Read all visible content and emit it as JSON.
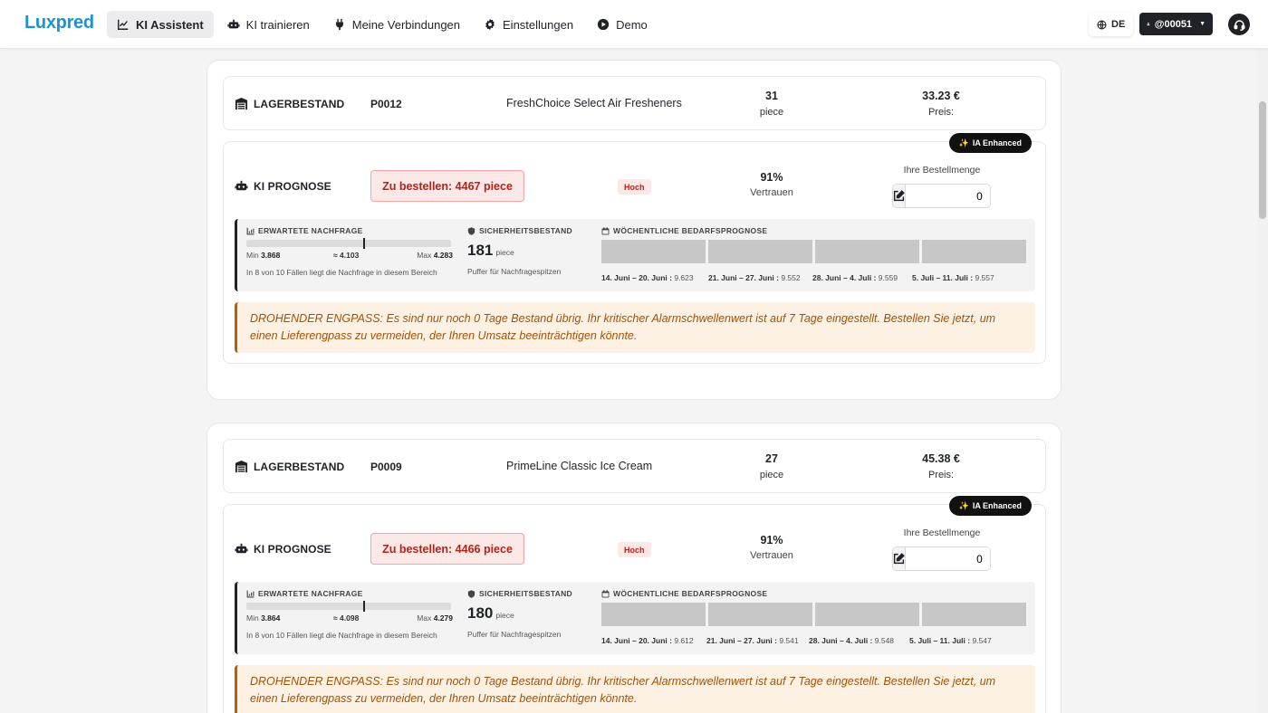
{
  "nav": {
    "brand": "Luxpred",
    "items": [
      {
        "label": "KI Assistent",
        "icon": "chart-line-icon",
        "active": true
      },
      {
        "label": "KI trainieren",
        "icon": "robot-icon",
        "active": false
      },
      {
        "label": "Meine Verbindungen",
        "icon": "plug-icon",
        "active": false
      },
      {
        "label": "Einstellungen",
        "icon": "gear-icon",
        "active": false
      },
      {
        "label": "Demo",
        "icon": "play-circle-icon",
        "active": false
      }
    ],
    "language": "DE",
    "user": "@00051"
  },
  "products": [
    {
      "stock_label": "LAGERBESTAND",
      "sku": "P0012",
      "name": "FreshChoice Select Air Fresheners",
      "stock_qty": "31",
      "stock_unit": "piece",
      "price": "33.23 €",
      "price_label": "Preis:",
      "ia_badge": "IA Enhanced",
      "forecast_label": "KI PROGNOSE",
      "order_text": "Zu bestellen: 4467 piece",
      "priority": "Hoch",
      "confidence": "91%",
      "confidence_label": "Vertrauen",
      "qty_label": "Ihre Bestellmenge",
      "qty_value": "0",
      "demand_head": "ERWARTETE NACHFRAGE",
      "demand_min_label": "Min",
      "demand_min": "3.868",
      "demand_mid": "≈ 4.103",
      "demand_max_label": "Max",
      "demand_max": "4.283",
      "demand_marker_fraction": 0.57,
      "demand_note": "In 8 von 10 Fällen liegt die Nachfrage in diesem Bereich",
      "safety_head": "SICHERHEITSBESTAND",
      "safety_value": "181",
      "safety_unit": "piece",
      "safety_note": "Puffer für Nachfragespitzen",
      "weekly_head": "WÖCHENTLICHE BEDARFSPROGNOSE",
      "weeks": [
        {
          "range": "14. Juni – 20. Juni :",
          "value": "9.623"
        },
        {
          "range": "21. Juni – 27. Juni :",
          "value": "9.552"
        },
        {
          "range": "28. Juni – 4. Juli :",
          "value": "9.559"
        },
        {
          "range": "5. Juli – 11. Juli :",
          "value": "9.557"
        }
      ],
      "alert": "DROHENDER ENGPASS: Es sind nur noch 0 Tage Bestand übrig. Ihr kritischer Alarmschwellenwert ist auf 7 Tage eingestellt. Bestellen Sie jetzt, um einen Lieferengpass zu vermeiden, der Ihren Umsatz beeinträchtigen könnte."
    },
    {
      "stock_label": "LAGERBESTAND",
      "sku": "P0009",
      "name": "PrimeLine Classic Ice Cream",
      "stock_qty": "27",
      "stock_unit": "piece",
      "price": "45.38 €",
      "price_label": "Preis:",
      "ia_badge": "IA Enhanced",
      "forecast_label": "KI PROGNOSE",
      "order_text": "Zu bestellen: 4466 piece",
      "priority": "Hoch",
      "confidence": "91%",
      "confidence_label": "Vertrauen",
      "qty_label": "Ihre Bestellmenge",
      "qty_value": "0",
      "demand_head": "ERWARTETE NACHFRAGE",
      "demand_min_label": "Min",
      "demand_min": "3.864",
      "demand_mid": "≈ 4.098",
      "demand_max_label": "Max",
      "demand_max": "4.279",
      "demand_marker_fraction": 0.57,
      "demand_note": "In 8 von 10 Fällen liegt die Nachfrage in diesem Bereich",
      "safety_head": "SICHERHEITSBESTAND",
      "safety_value": "180",
      "safety_unit": "piece",
      "safety_note": "Puffer für Nachfragespitzen",
      "weekly_head": "WÖCHENTLICHE BEDARFSPROGNOSE",
      "weeks": [
        {
          "range": "14. Juni – 20. Juni :",
          "value": "9.612"
        },
        {
          "range": "21. Juni – 27. Juni :",
          "value": "9.541"
        },
        {
          "range": "28. Juni – 4. Juli :",
          "value": "9.548"
        },
        {
          "range": "5. Juli – 11. Juli :",
          "value": "9.547"
        }
      ],
      "alert": "DROHENDER ENGPASS: Es sind nur noch 0 Tage Bestand übrig. Ihr kritischer Alarmschwellenwert ist auf 7 Tage eingestellt. Bestellen Sie jetzt, um einen Lieferengpass zu vermeiden, der Ihren Umsatz beeinträchtigen könnte."
    }
  ],
  "colors": {
    "brand": "#1f93cf",
    "danger": "#b42318",
    "warning_text": "#a15207",
    "warning_bg": "#fdf1e4"
  }
}
